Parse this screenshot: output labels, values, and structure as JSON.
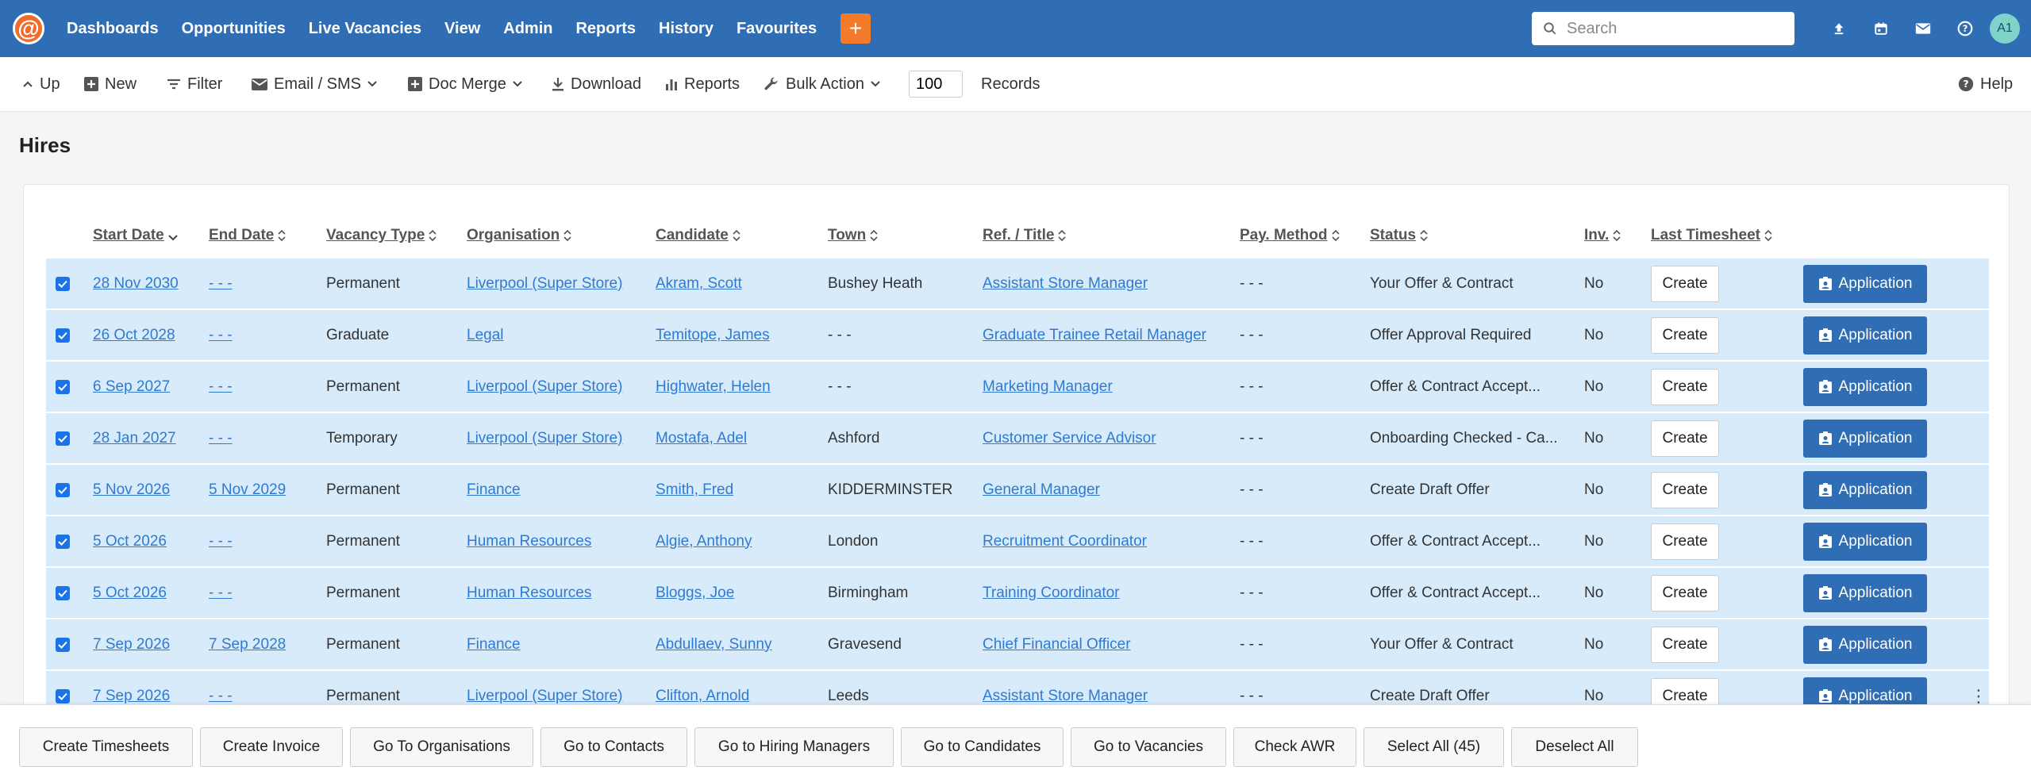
{
  "nav": {
    "items": [
      "Dashboards",
      "Opportunities",
      "Live Vacancies",
      "View",
      "Admin",
      "Reports",
      "History",
      "Favourites"
    ],
    "plus_label": "+",
    "search_placeholder": "Search",
    "avatar_initials": "A1"
  },
  "toolbar": {
    "up": "Up",
    "new": "New",
    "filter": "Filter",
    "email_sms": "Email / SMS",
    "doc_merge": "Doc Merge",
    "download": "Download",
    "reports": "Reports",
    "bulk_action": "Bulk Action",
    "records_value": "100",
    "records_label": "Records",
    "help": "Help"
  },
  "page": {
    "title": "Hires"
  },
  "table": {
    "headers": {
      "start_date": "Start Date",
      "end_date": "End Date",
      "vacancy_type": "Vacancy Type",
      "organisation": "Organisation",
      "candidate": "Candidate",
      "town": "Town",
      "ref_title": "Ref. / Title",
      "pay_method": "Pay. Method",
      "status": "Status",
      "inv": "Inv.",
      "last_timesheet": "Last Timesheet"
    },
    "create_label": "Create",
    "application_label": "Application",
    "rows": [
      {
        "start": "28 Nov 2030",
        "end": "- - -",
        "type": "Permanent",
        "org": "Liverpool (Super Store)",
        "candidate": "Akram, Scott",
        "town": "Bushey Heath",
        "ref": "Assistant Store Manager",
        "pay": "- - -",
        "status": "Your Offer & Contract",
        "inv": "No"
      },
      {
        "start": "26 Oct 2028",
        "end": "- - -",
        "type": "Graduate",
        "org": "Legal",
        "candidate": "Temitope, James",
        "town": "- - -",
        "ref": "Graduate Trainee Retail Manager",
        "pay": "- - -",
        "status": "Offer Approval Required",
        "inv": "No"
      },
      {
        "start": "6 Sep 2027",
        "end": "- - -",
        "type": "Permanent",
        "org": "Liverpool (Super Store)",
        "candidate": "Highwater, Helen",
        "town": "- - -",
        "ref": "Marketing Manager",
        "pay": "- - -",
        "status": "Offer & Contract Accept...",
        "inv": "No"
      },
      {
        "start": "28 Jan 2027",
        "end": "- - -",
        "type": "Temporary",
        "org": "Liverpool (Super Store)",
        "candidate": "Mostafa, Adel",
        "town": "Ashford",
        "ref": "Customer Service Advisor",
        "pay": "- - -",
        "status": "Onboarding Checked - Ca...",
        "inv": "No"
      },
      {
        "start": "5 Nov 2026",
        "end": "5 Nov 2029",
        "type": "Permanent",
        "org": "Finance",
        "candidate": "Smith, Fred",
        "town": "KIDDERMINSTER",
        "ref": "General Manager",
        "pay": "- - -",
        "status": "Create Draft Offer",
        "inv": "No"
      },
      {
        "start": "5 Oct 2026",
        "end": "- - -",
        "type": "Permanent",
        "org": "Human Resources",
        "candidate": "Algie, Anthony",
        "town": "London",
        "ref": "Recruitment Coordinator",
        "pay": "- - -",
        "status": "Offer & Contract Accept...",
        "inv": "No"
      },
      {
        "start": "5 Oct 2026",
        "end": "- - -",
        "type": "Permanent",
        "org": "Human Resources",
        "candidate": "Bloggs, Joe",
        "town": "Birmingham",
        "ref": "Training Coordinator",
        "pay": "- - -",
        "status": "Offer & Contract Accept...",
        "inv": "No"
      },
      {
        "start": "7 Sep 2026",
        "end": "7 Sep 2028",
        "type": "Permanent",
        "org": "Finance",
        "candidate": "Abdullaev, Sunny",
        "town": "Gravesend",
        "ref": "Chief Financial Officer",
        "pay": "- - -",
        "status": "Your Offer & Contract",
        "inv": "No"
      },
      {
        "start": "7 Sep 2026",
        "end": "- - -",
        "type": "Permanent",
        "org": "Liverpool (Super Store)",
        "candidate": "Clifton, Arnold",
        "town": "Leeds",
        "ref": "Assistant Store Manager",
        "pay": "- - -",
        "status": "Create Draft Offer",
        "inv": "No"
      }
    ]
  },
  "bottom": {
    "buttons": [
      "Create Timesheets",
      "Create Invoice",
      "Go To Organisations",
      "Go to Contacts",
      "Go to Hiring Managers",
      "Go to Candidates",
      "Go to Vacancies",
      "Check AWR",
      "Select All (45)",
      "Deselect All"
    ]
  }
}
